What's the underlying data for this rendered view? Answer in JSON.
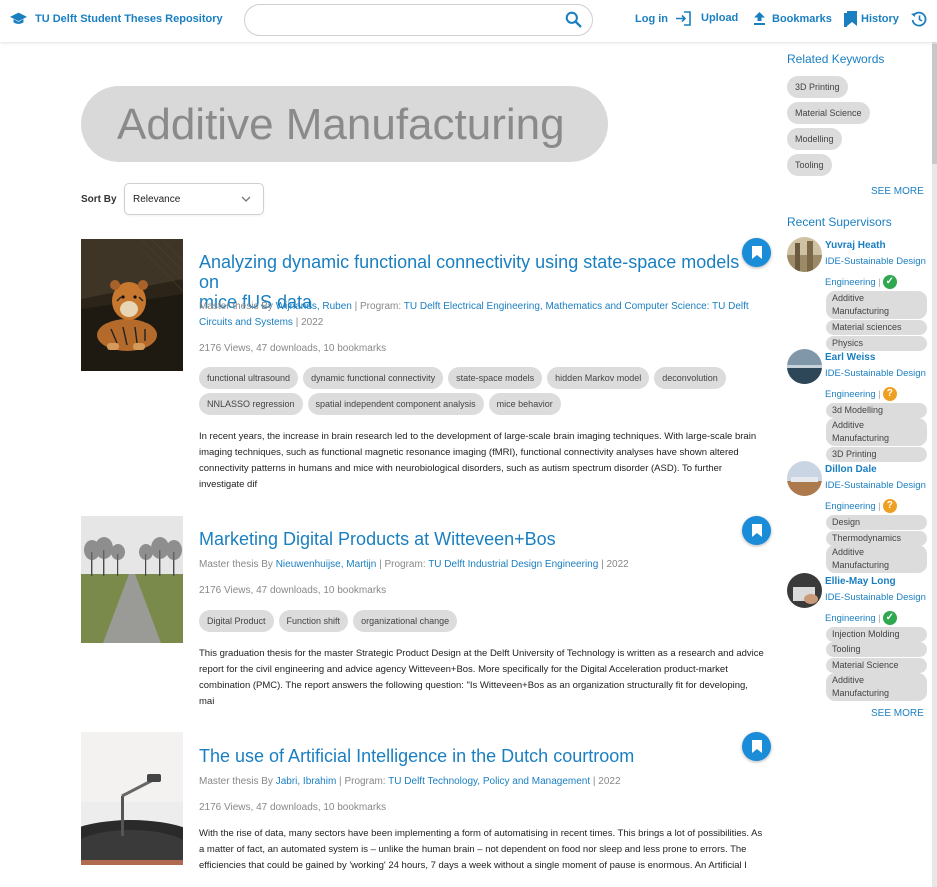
{
  "header": {
    "brand": "TU Delft Student Theses Repository",
    "search_placeholder": "",
    "nav": {
      "login": "Log in",
      "upload": "Upload",
      "bookmarks": "Bookmarks",
      "history": "History"
    }
  },
  "page": {
    "title": "Additive Manufacturing",
    "sort_label": "Sort By",
    "sort_value": "Relevance"
  },
  "theses": [
    {
      "title_line1": "Analyzing dynamic functional connectivity using state-space models on",
      "title_line2": "mice fUS data",
      "type": "Master thesis",
      "by": "By",
      "author": "Wijnands, Ruben",
      "program_label": "Program:",
      "program": "TU Delft Electrical Engineering, Mathematics and Computer Science: TU Delft Circuits and Systems",
      "year": "2022",
      "stats": "2176 Views, 47 downloads, 10 bookmarks",
      "keywords": [
        "functional ultrasound",
        "dynamic functional connectivity",
        "state-space models",
        "hidden Markov model",
        "deconvolution",
        "NNLASSO regression",
        "spatial independent component analysis",
        "mice behavior"
      ],
      "abstract": "In recent years, the increase in brain research led to the development of large-scale brain imaging techniques. With large-scale brain imaging techniques, such as functional magnetic resonance imaging (fMRI), functional connectivity analyses have shown altered connectivity patterns in humans and mice with neurobiological disorders, such as autism spectrum disorder (ASD). To further investigate dif"
    },
    {
      "title_line1": "Marketing Digital Products at Witteveen+Bos",
      "title_line2": "",
      "type": "Master thesis",
      "by": "By",
      "author": "Nieuwenhuijse, Martijn",
      "program_label": "Program:",
      "program": "TU Delft Industrial Design Engineering",
      "year": "2022",
      "stats": "2176 Views, 47 downloads, 10 bookmarks",
      "keywords": [
        "Digital Product",
        "Function shift",
        "organizational change"
      ],
      "abstract": "This graduation thesis for the master Strategic Product Design at the Delft University of Technology is written as a research and advice report for the civil engineering and advice agency Witteveen+Bos. More specifically for the Digital Acceleration product-market combination (PMC). The report answers the following question: \"Is Witteveen+Bos as an organization structurally fit for developing, mai"
    },
    {
      "title_line1": "The use of Artificial Intelligence in the Dutch courtroom",
      "title_line2": "",
      "type": "Master thesis",
      "by": "By",
      "author": "Jabri, Ibrahim",
      "program_label": "Program:",
      "program": "TU Delft Technology, Policy and Management",
      "year": "2022",
      "stats": "2176 Views, 47 downloads, 10 bookmarks",
      "keywords": [],
      "abstract": "With the rise of data, many sectors have been implementing a form of automatising in recent times. This brings a lot of possibilities. As a matter of fact, an automated system is – unlike the human brain – not dependent on food nor sleep and less prone to errors. The efficiencies that could be gained by 'working' 24 hours, 7 days a week without a single moment of pause is enormous. An Artificial I"
    }
  ],
  "sidebar": {
    "keywords_title": "Related Keywords",
    "keywords": [
      "3D Printing",
      "Material Science",
      "Modelling",
      "Tooling"
    ],
    "see_more": "SEE MORE",
    "supervisors_title": "Recent Supervisors",
    "supervisors": [
      {
        "name": "Yuvraj Heath",
        "program_line1": "IDE-Sustainable Design",
        "program_line2": "Engineering",
        "sep": "|",
        "status": "check",
        "keywords": [
          "Additive Manufacturing",
          "Material sciences",
          "Physics"
        ]
      },
      {
        "name": "Earl Weiss",
        "program_line1": "IDE-Sustainable Design",
        "program_line2": "Engineering",
        "sep": "|",
        "status": "question",
        "keywords": [
          "3d Modelling",
          "Additive Manufacturing",
          "3D Printing"
        ]
      },
      {
        "name": "Dillon Dale",
        "program_line1": "IDE-Sustainable Design",
        "program_line2": "Engineering",
        "sep": "|",
        "status": "question",
        "keywords": [
          "Design",
          "Thermodynamics",
          "Additive Manufacturing"
        ]
      },
      {
        "name": "Ellie-May Long",
        "program_line1": "IDE-Sustainable Design",
        "program_line2": "Engineering",
        "sep": "|",
        "status": "check",
        "keywords": [
          "Injection Molding",
          "Tooling",
          "Material Science",
          "Additive Manufacturing"
        ]
      }
    ],
    "see_more_2": "SEE MORE"
  },
  "colors": {
    "accent": "#1a7fc1",
    "bookmark_button": "#1a8cd8",
    "status_check": "#2fa84f",
    "status_question": "#f0a020",
    "chip": "#dcdcdc"
  }
}
